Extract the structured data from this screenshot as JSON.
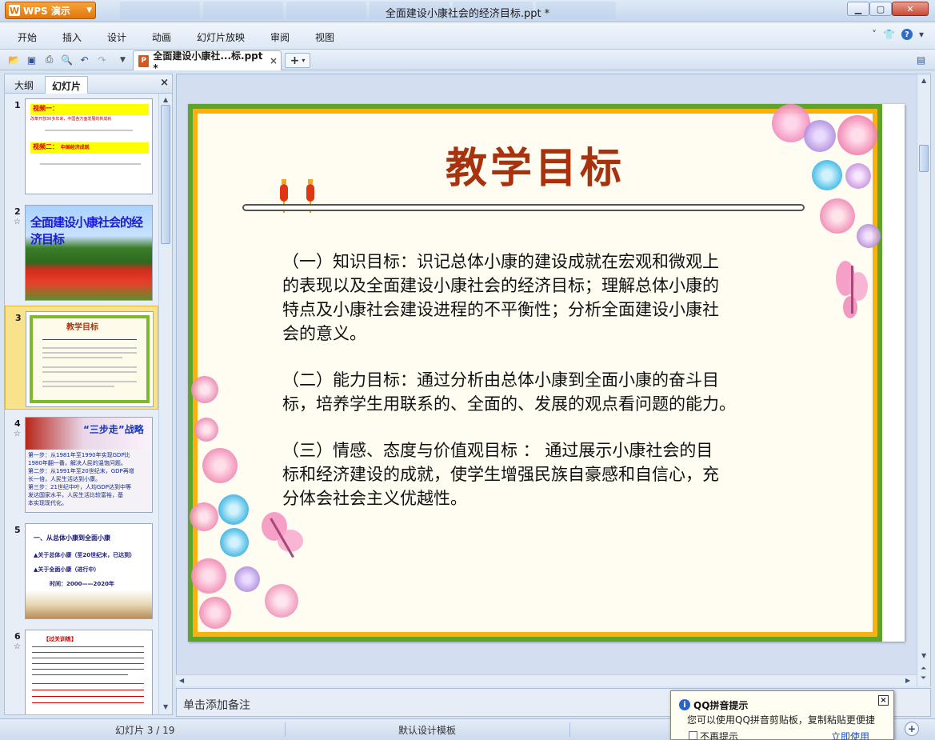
{
  "app": {
    "name": "WPS 演示",
    "logo": "W"
  },
  "window": {
    "title": "全面建设小康社会的经济目标.ppt *"
  },
  "menu": {
    "items": [
      "开始",
      "插入",
      "设计",
      "动画",
      "幻灯片放映",
      "审阅",
      "视图"
    ]
  },
  "toolbar": {
    "icons": [
      "open-folder-icon",
      "save-icon",
      "print-icon",
      "print-preview-icon",
      "undo-icon",
      "redo-icon",
      "dropdown-icon"
    ],
    "doc_tab": "全面建设小康社...标.ppt *",
    "doc_tab_close": "×",
    "new_tab": "+"
  },
  "left_pane": {
    "tabs": [
      "大纲",
      "幻灯片"
    ],
    "close": "×",
    "thumbnails": [
      {
        "num": "1",
        "star": "",
        "band1": "视频一：",
        "sub1": "改革开放30多年来，中国各方面发展的新成就",
        "band2": "视频二：",
        "sub2": "中国经济成就"
      },
      {
        "num": "2",
        "star": "☆",
        "title": "全面建设小康社会的经济目标"
      },
      {
        "num": "3",
        "star": "",
        "title": "教学目标"
      },
      {
        "num": "4",
        "star": "☆",
        "title": "“三步走”战略",
        "lines": [
          "第一步：从1981年至1990年实现GDP比",
          "1980年翻一番，解决人民的温饱问题。",
          "第二步：从1991年至20世纪末，GDP再增",
          "长一倍，人民生活达到小康。",
          "第三步：21世纪中叶，人均GDP达到中等",
          "发达国家水平，人民生活比较富裕，基",
          "本实现现代化。"
        ]
      },
      {
        "num": "5",
        "star": "",
        "lines": [
          "一、从总体小康到全面小康",
          "▲关于总体小康（至20世纪末，已达到）",
          "▲关于全面小康（进行中）",
          "时间：2000——2020年"
        ]
      },
      {
        "num": "6",
        "star": "☆",
        "title": "【过关训练】"
      }
    ]
  },
  "slide": {
    "title": "教学目标",
    "paragraphs": [
      [
        "（一）知识目标：识记总体小康的建设成就在宏观和微观上",
        "的表现以及全面建设小康社会的经济目标；理解总体小康的",
        "特点及小康社会建设进程的不平衡性；分析全面建设小康社",
        "会的意义。"
      ],
      [
        "（二）能力目标：通过分析由总体小康到全面小康的奋斗目",
        "标，培养学生用联系的、全面的、发展的观点看问题的能力。"
      ],
      [
        "（三）情感、态度与价值观目标 ： 通过展示小康社会的目",
        "标和经济建设的成就，使学生增强民族自豪感和自信心，充",
        "分体会社会主义优越性。"
      ]
    ]
  },
  "notes": {
    "placeholder": "单击添加备注"
  },
  "status": {
    "slide_counter": "幻灯片 3 / 19",
    "template": "默认设计模板",
    "zoom_in": "+"
  },
  "qq_popup": {
    "title": "QQ拼音提示",
    "message": "您可以使用QQ拼音剪贴板，复制粘贴更便捷",
    "checkbox_label": "不再提示",
    "link": "立即使用",
    "close": "×"
  },
  "colors": {
    "accent": "#e2760b",
    "slide_green": "#5da52a",
    "slide_gold": "#f9b10f",
    "title_red": "#a8320e"
  }
}
